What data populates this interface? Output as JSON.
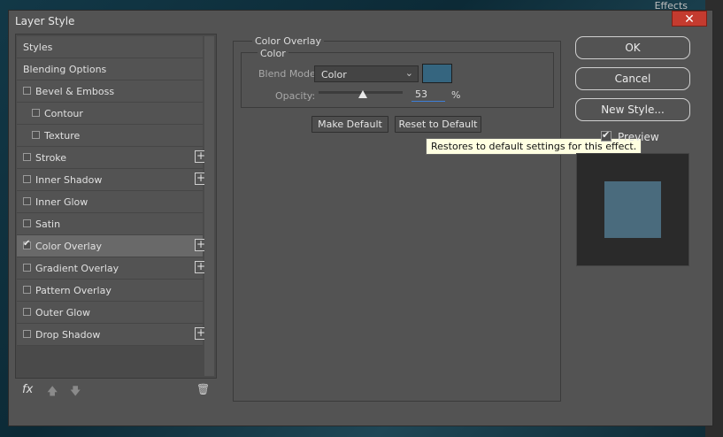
{
  "dialog": {
    "title": "Layer Style",
    "close_glyph": "✕"
  },
  "background": {
    "top_hint": "Effects"
  },
  "styles_list": [
    {
      "label": "Styles",
      "checkbox": false,
      "indent": false,
      "add": false,
      "selected": false
    },
    {
      "label": "Blending Options",
      "checkbox": false,
      "indent": false,
      "add": false,
      "selected": false
    },
    {
      "label": "Bevel & Emboss",
      "checkbox": true,
      "checked": false,
      "indent": false,
      "add": false,
      "selected": false
    },
    {
      "label": "Contour",
      "checkbox": true,
      "checked": false,
      "indent": true,
      "add": false,
      "selected": false
    },
    {
      "label": "Texture",
      "checkbox": true,
      "checked": false,
      "indent": true,
      "add": false,
      "selected": false
    },
    {
      "label": "Stroke",
      "checkbox": true,
      "checked": false,
      "indent": false,
      "add": true,
      "selected": false
    },
    {
      "label": "Inner Shadow",
      "checkbox": true,
      "checked": false,
      "indent": false,
      "add": true,
      "selected": false
    },
    {
      "label": "Inner Glow",
      "checkbox": true,
      "checked": false,
      "indent": false,
      "add": false,
      "selected": false
    },
    {
      "label": "Satin",
      "checkbox": true,
      "checked": false,
      "indent": false,
      "add": false,
      "selected": false
    },
    {
      "label": "Color Overlay",
      "checkbox": true,
      "checked": true,
      "indent": false,
      "add": true,
      "selected": true
    },
    {
      "label": "Gradient Overlay",
      "checkbox": true,
      "checked": false,
      "indent": false,
      "add": true,
      "selected": false
    },
    {
      "label": "Pattern Overlay",
      "checkbox": true,
      "checked": false,
      "indent": false,
      "add": false,
      "selected": false
    },
    {
      "label": "Outer Glow",
      "checkbox": true,
      "checked": false,
      "indent": false,
      "add": false,
      "selected": false
    },
    {
      "label": "Drop Shadow",
      "checkbox": true,
      "checked": false,
      "indent": false,
      "add": true,
      "selected": false
    }
  ],
  "left_footer": {
    "fx_label": "fx",
    "up_glyph": "🡅",
    "down_glyph": "🡇",
    "trash_glyph": "🗑"
  },
  "color_overlay": {
    "section_title": "Color Overlay",
    "group_title": "Color",
    "blend_mode_label": "Blend Mode:",
    "blend_mode_value": "Color",
    "chevron": "⌄",
    "overlay_color": "#35657f",
    "opacity_label": "Opacity:",
    "opacity_value": "53",
    "opacity_unit": "%",
    "opacity_fraction": 0.53,
    "make_default_label": "Make Default",
    "reset_default_label": "Reset to Default",
    "tooltip": "Restores to default settings for this effect."
  },
  "right_column": {
    "ok_label": "OK",
    "cancel_label": "Cancel",
    "new_style_label": "New Style...",
    "preview_label": "Preview",
    "preview_color": "#4a6b7d"
  }
}
